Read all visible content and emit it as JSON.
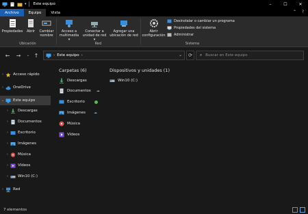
{
  "window": {
    "title": "Este equipo",
    "qat_dropdown": "▾"
  },
  "tabs": [
    "Archivo",
    "Equipo",
    "Vista"
  ],
  "ribbon": {
    "ubicacion": {
      "label": "Ubicación",
      "buttons": [
        "Propiedades",
        "Abrir",
        "Cambiar nombre"
      ]
    },
    "red": {
      "label": "Red",
      "buttons": [
        "Acceso a multimedia ▾",
        "Conectar a unidad de red ▾",
        "Agregar una ubicación de red"
      ]
    },
    "sistema": {
      "label": "Sistema",
      "open_settings": "Abrir configuración",
      "small": [
        "Desinstalar o cambiar un programa",
        "Propiedades del sistema",
        "Administrar"
      ]
    }
  },
  "address": {
    "path": "Este equipo",
    "separator": "›",
    "search_placeholder": "Buscar en Este equipo"
  },
  "nav": [
    {
      "label": "Acceso rápido",
      "icon": "star-icon",
      "chev": "›"
    },
    {
      "label": "OneDrive",
      "icon": "cloud-icon",
      "chev": "›"
    },
    {
      "label": "Este equipo",
      "icon": "computer-icon",
      "chev": "⌄",
      "selected": true
    },
    {
      "label": "Descargas",
      "icon": "download-icon",
      "chev": "›"
    },
    {
      "label": "Documentos",
      "icon": "documents-icon",
      "chev": "›"
    },
    {
      "label": "Escritorio",
      "icon": "desktop-icon",
      "chev": "›"
    },
    {
      "label": "Imágenes",
      "icon": "pictures-icon",
      "chev": "›"
    },
    {
      "label": "Música",
      "icon": "music-icon",
      "chev": "›"
    },
    {
      "label": "Vídeos",
      "icon": "videos-icon",
      "chev": "›"
    },
    {
      "label": "Win10 (C:)",
      "icon": "drive-icon",
      "chev": "›"
    },
    {
      "label": "Red",
      "icon": "network-icon",
      "chev": "›"
    }
  ],
  "content": {
    "folders_header": "Carpetas (6)",
    "drives_header": "Dispositivos y unidades (1)",
    "folders": [
      "Descargas",
      "Documentos",
      "Escritorio",
      "Imágenes",
      "Música",
      "Vídeos"
    ],
    "drives": [
      "Win10 (C:)"
    ]
  },
  "status": {
    "count": "7 elementos"
  },
  "colors": {
    "accent": "#1a5fb4",
    "background": "#191919",
    "ribbon": "#2b2b2b"
  }
}
